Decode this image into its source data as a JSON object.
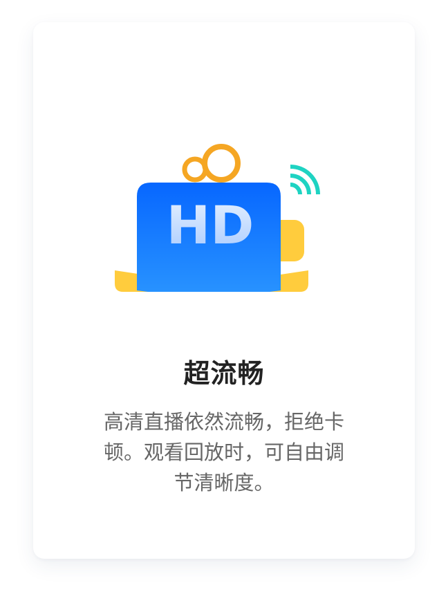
{
  "feature_card": {
    "title": "超流畅",
    "description_lines": [
      "高清直播依然流畅，拒绝卡",
      "顿。观看回放时，可自由调",
      "节清晰度。"
    ]
  },
  "illustration": {
    "badge_text": "HD",
    "icon": "hd-camera-icon",
    "colors": {
      "camera_blue": "#0f7bff",
      "reel_orange": "#f5a623",
      "base_yellow": "#ffcc3d",
      "signal_teal": "#1ed3c2"
    }
  }
}
